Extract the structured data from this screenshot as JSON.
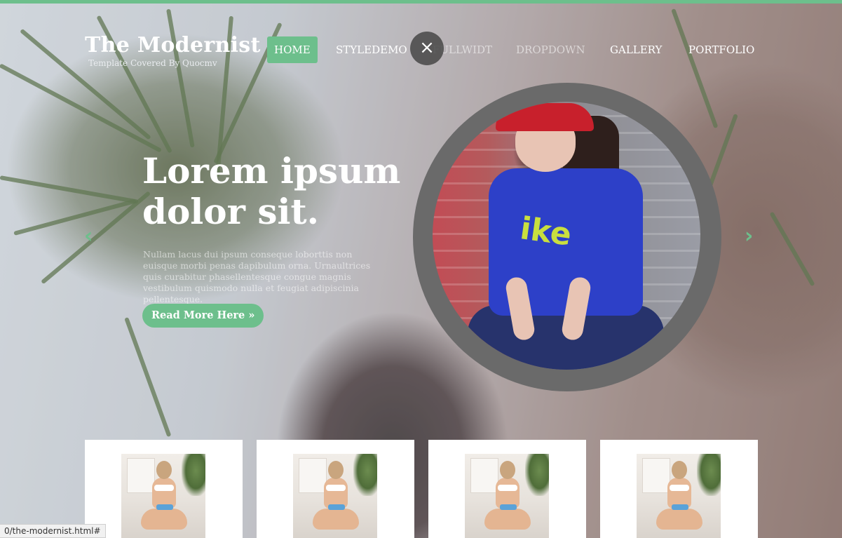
{
  "brand": {
    "title": "The Modernist",
    "subtitle": "Template Covered By Quocmv"
  },
  "nav": {
    "items": [
      {
        "label": "HOME",
        "active": true
      },
      {
        "label": "STYLEDEMO",
        "active": false
      },
      {
        "label": "FULLWIDT",
        "active": false
      },
      {
        "label": "DROPDOWN",
        "active": false
      },
      {
        "label": "GALLERY",
        "active": false
      },
      {
        "label": "PORTFOLIO",
        "active": false
      }
    ],
    "close_icon": "×"
  },
  "slide": {
    "heading": "Lorem ipsum dolor sit.",
    "body": "Nullam lacus dui ipsum conseque loborttis non euisque morbi penas dapibulum orna. Urnaultrices quis curabitur phasellentesque congue magnis vestibulum quismodo nulla et feugiat adipiscinia pellentesque.",
    "button_label": "Read More Here »",
    "prev_arrow": "‹",
    "next_arrow": "›"
  },
  "gallery": {
    "thumbnails": [
      {
        "name": "thumb-1"
      },
      {
        "name": "thumb-2"
      },
      {
        "name": "thumb-3"
      },
      {
        "name": "thumb-4"
      }
    ]
  },
  "status_bar": {
    "url": "0/the-modernist.html#"
  },
  "colors": {
    "accent": "#6dbf8c",
    "circle_frame": "#6a6a6a",
    "text_light": "#ffffff"
  }
}
